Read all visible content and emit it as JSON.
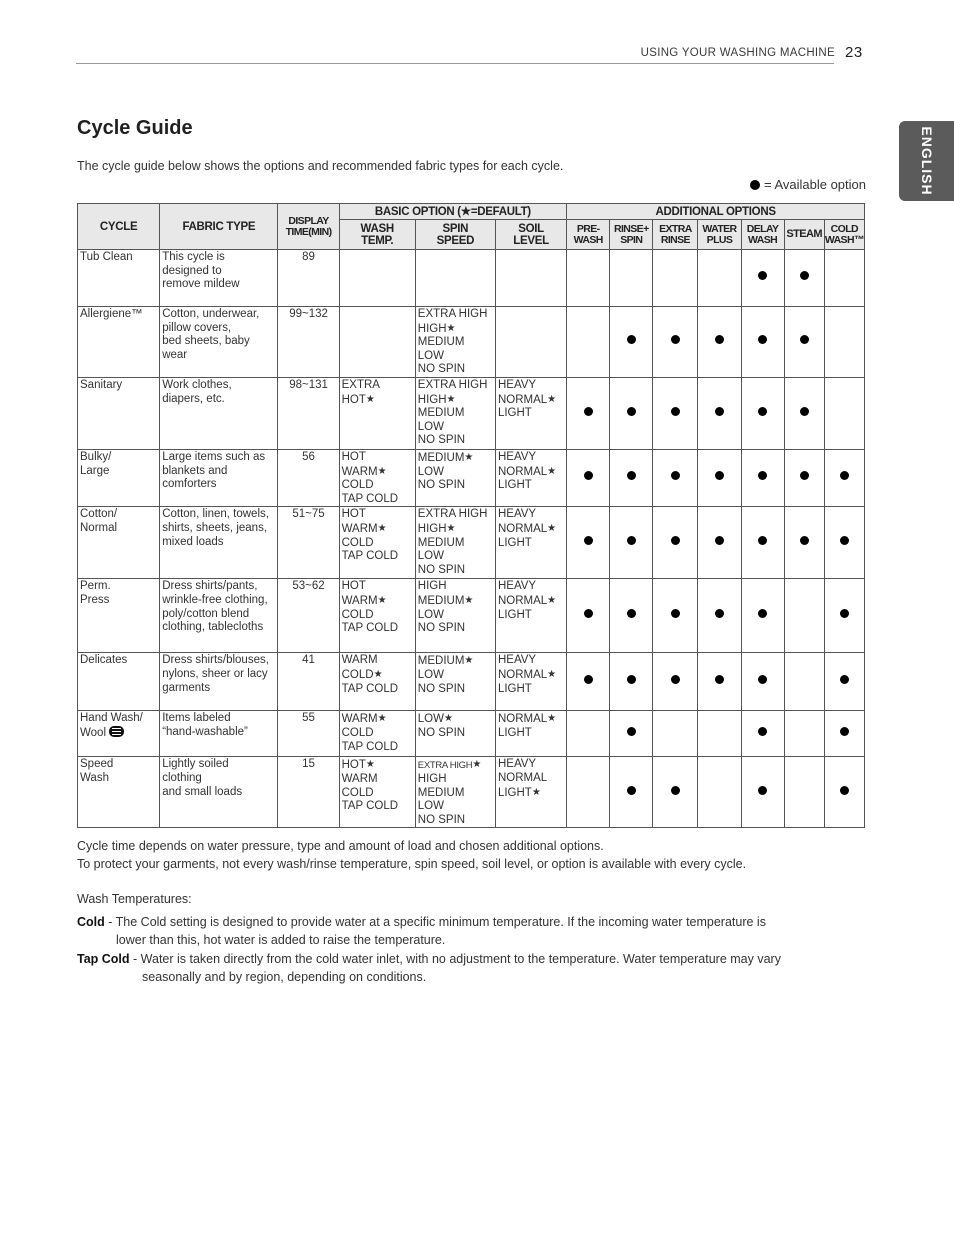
{
  "header": {
    "running_head": "USING YOUR WASHING MACHINE",
    "page_number": "23",
    "language_tab": "ENGLISH"
  },
  "title": "Cycle Guide",
  "intro": "The cycle guide below shows the options and recommended fabric types for each cycle.",
  "legend": {
    "icon": "filled-circle",
    "text": "= Available option"
  },
  "table": {
    "headers": {
      "cycle": "CYCLE",
      "fabric_type": "FABRIC TYPE",
      "display_time_1": "DISPLAY",
      "display_time_2": "TIME(MIN)",
      "basic_group": "BASIC OPTION (★=DEFAULT)",
      "wash_temp_1": "WASH",
      "wash_temp_2": "TEMP.",
      "spin_speed_1": "SPIN",
      "spin_speed_2": "SPEED",
      "soil_level_1": "SOIL",
      "soil_level_2": "LEVEL",
      "additional_group": "ADDITIONAL OPTIONS",
      "additional": [
        {
          "l1": "PRE-",
          "l2": "WASH"
        },
        {
          "l1": "RINSE+",
          "l2": "SPIN"
        },
        {
          "l1": "EXTRA",
          "l2": "RINSE"
        },
        {
          "l1": "WATER",
          "l2": "PLUS"
        },
        {
          "l1": "DELAY",
          "l2": "WASH"
        },
        {
          "l1": "STEAM",
          "l2": ""
        },
        {
          "l1": "COLD",
          "l2": "WASH™"
        }
      ]
    },
    "rows": [
      {
        "cycle": [
          "Tub Clean"
        ],
        "fabric": [
          "This cycle is",
          "designed to",
          "remove mildew"
        ],
        "time": "89",
        "wash_temp": [],
        "spin_speed": [],
        "soil_level": [],
        "options": [
          false,
          false,
          false,
          false,
          true,
          true,
          false
        ]
      },
      {
        "cycle": [
          "Allergiene™"
        ],
        "fabric": [
          "Cotton, underwear,",
          "pillow covers,",
          "bed sheets, baby",
          "wear"
        ],
        "time": "99~132",
        "wash_temp": [],
        "spin_speed": [
          {
            "t": "EXTRA HIGH",
            "d": false
          },
          {
            "t": "HIGH",
            "d": true
          },
          {
            "t": "MEDIUM",
            "d": false
          },
          {
            "t": "LOW",
            "d": false
          },
          {
            "t": "NO SPIN",
            "d": false
          }
        ],
        "soil_level": [],
        "options": [
          false,
          true,
          true,
          true,
          true,
          true,
          false
        ]
      },
      {
        "cycle": [
          "Sanitary"
        ],
        "fabric": [
          "Work clothes,",
          "diapers, etc."
        ],
        "time": "98~131",
        "wash_temp": [
          {
            "t": "EXTRA HOT",
            "d": true
          }
        ],
        "spin_speed": [
          {
            "t": "EXTRA HIGH",
            "d": false
          },
          {
            "t": "HIGH",
            "d": true
          },
          {
            "t": "MEDIUM",
            "d": false
          },
          {
            "t": "LOW",
            "d": false
          },
          {
            "t": "NO SPIN",
            "d": false
          }
        ],
        "soil_level": [
          {
            "t": "HEAVY",
            "d": false
          },
          {
            "t": "NORMAL",
            "d": true
          },
          {
            "t": "LIGHT",
            "d": false
          }
        ],
        "options": [
          true,
          true,
          true,
          true,
          true,
          true,
          false
        ]
      },
      {
        "cycle": [
          "Bulky/",
          "Large"
        ],
        "fabric": [
          "Large items such as",
          "blankets and",
          "comforters"
        ],
        "time": "56",
        "wash_temp": [
          {
            "t": "HOT",
            "d": false
          },
          {
            "t": "WARM",
            "d": true
          },
          {
            "t": "COLD",
            "d": false
          },
          {
            "t": "TAP COLD",
            "d": false
          }
        ],
        "spin_speed": [
          {
            "t": "MEDIUM",
            "d": true
          },
          {
            "t": "LOW",
            "d": false
          },
          {
            "t": "NO SPIN",
            "d": false
          }
        ],
        "soil_level": [
          {
            "t": "HEAVY",
            "d": false
          },
          {
            "t": "NORMAL",
            "d": true
          },
          {
            "t": "LIGHT",
            "d": false
          }
        ],
        "options": [
          true,
          true,
          true,
          true,
          true,
          true,
          true
        ]
      },
      {
        "cycle": [
          "Cotton/",
          "Normal"
        ],
        "fabric": [
          "Cotton, linen, towels,",
          "shirts, sheets, jeans,",
          "mixed loads"
        ],
        "time": "51~75",
        "wash_temp": [
          {
            "t": "HOT",
            "d": false
          },
          {
            "t": "WARM",
            "d": true
          },
          {
            "t": "COLD",
            "d": false
          },
          {
            "t": "TAP COLD",
            "d": false
          }
        ],
        "spin_speed": [
          {
            "t": "EXTRA HIGH",
            "d": false
          },
          {
            "t": "HIGH",
            "d": true
          },
          {
            "t": "MEDIUM",
            "d": false
          },
          {
            "t": "LOW",
            "d": false
          },
          {
            "t": "NO SPIN",
            "d": false
          }
        ],
        "soil_level": [
          {
            "t": "HEAVY",
            "d": false
          },
          {
            "t": "NORMAL",
            "d": true
          },
          {
            "t": "LIGHT",
            "d": false
          }
        ],
        "options": [
          true,
          true,
          true,
          true,
          true,
          true,
          true
        ]
      },
      {
        "cycle": [
          "Perm.",
          "Press"
        ],
        "fabric": [
          "Dress shirts/pants,",
          "wrinkle-free clothing,",
          "poly/cotton blend",
          "clothing, tablecloths"
        ],
        "time": "53~62",
        "wash_temp": [
          {
            "t": "HOT",
            "d": false
          },
          {
            "t": "WARM",
            "d": true
          },
          {
            "t": "COLD",
            "d": false
          },
          {
            "t": "TAP COLD",
            "d": false
          }
        ],
        "spin_speed": [
          {
            "t": "HIGH",
            "d": false
          },
          {
            "t": "MEDIUM",
            "d": true
          },
          {
            "t": "LOW",
            "d": false
          },
          {
            "t": "NO SPIN",
            "d": false
          }
        ],
        "soil_level": [
          {
            "t": "HEAVY",
            "d": false
          },
          {
            "t": "NORMAL",
            "d": true
          },
          {
            "t": "LIGHT",
            "d": false
          }
        ],
        "options": [
          true,
          true,
          true,
          true,
          true,
          false,
          true
        ]
      },
      {
        "cycle": [
          "Delicates"
        ],
        "fabric": [
          "Dress shirts/blouses,",
          "nylons, sheer or lacy",
          "garments"
        ],
        "time": "41",
        "wash_temp": [
          {
            "t": "WARM",
            "d": false
          },
          {
            "t": "COLD",
            "d": true
          },
          {
            "t": "TAP COLD",
            "d": false
          }
        ],
        "spin_speed": [
          {
            "t": "MEDIUM",
            "d": true
          },
          {
            "t": "LOW",
            "d": false
          },
          {
            "t": "NO SPIN",
            "d": false
          }
        ],
        "soil_level": [
          {
            "t": "HEAVY",
            "d": false
          },
          {
            "t": "NORMAL",
            "d": true
          },
          {
            "t": "LIGHT",
            "d": false
          }
        ],
        "options": [
          true,
          true,
          true,
          true,
          true,
          false,
          true
        ]
      },
      {
        "cycle": [
          "Hand Wash/",
          "Wool"
        ],
        "cycle_icon": "wool-icon",
        "fabric": [
          "Items labeled",
          "“hand-washable”"
        ],
        "time": "55",
        "wash_temp": [
          {
            "t": "WARM",
            "d": true
          },
          {
            "t": "COLD",
            "d": false
          },
          {
            "t": "TAP COLD",
            "d": false
          }
        ],
        "spin_speed": [
          {
            "t": "LOW",
            "d": true
          },
          {
            "t": "NO SPIN",
            "d": false
          }
        ],
        "soil_level": [
          {
            "t": "NORMAL",
            "d": true
          },
          {
            "t": "LIGHT",
            "d": false
          }
        ],
        "options": [
          false,
          true,
          false,
          false,
          true,
          false,
          true
        ]
      },
      {
        "cycle": [
          "Speed",
          "Wash"
        ],
        "fabric": [
          "Lightly soiled",
          "clothing",
          "and small loads"
        ],
        "time": "15",
        "wash_temp": [
          {
            "t": "HOT",
            "d": true
          },
          {
            "t": "WARM",
            "d": false
          },
          {
            "t": "COLD",
            "d": false
          },
          {
            "t": "TAP COLD",
            "d": false
          }
        ],
        "spin_speed": [
          {
            "t": "EXTRA HIGH",
            "d": true,
            "small": true
          },
          {
            "t": "HIGH",
            "d": false
          },
          {
            "t": "MEDIUM",
            "d": false
          },
          {
            "t": "LOW",
            "d": false
          },
          {
            "t": "NO SPIN",
            "d": false
          }
        ],
        "soil_level": [
          {
            "t": "HEAVY",
            "d": false
          },
          {
            "t": "NORMAL",
            "d": false
          },
          {
            "t": "LIGHT",
            "d": true
          }
        ],
        "options": [
          false,
          true,
          true,
          false,
          true,
          false,
          true
        ]
      }
    ]
  },
  "notes": [
    "Cycle time depends on water pressure, type and amount of load and chosen additional options.",
    "To protect your garments, not every wash/rinse temperature, spin speed, soil level, or option is available with every cycle."
  ],
  "wash_temperatures": {
    "heading": "Wash Temperatures:",
    "items": [
      {
        "term": "Cold",
        "line1": " - The Cold setting is designed to provide water at a specific minimum temperature. If the incoming water temperature is",
        "line2": "lower than this, hot water is added to raise the temperature."
      },
      {
        "term": "Tap Cold",
        "line1": " - Water is taken directly from the cold water inlet, with no adjustment to the temperature. Water temperature may vary",
        "line2": "seasonally and by region, depending on conditions."
      }
    ]
  }
}
